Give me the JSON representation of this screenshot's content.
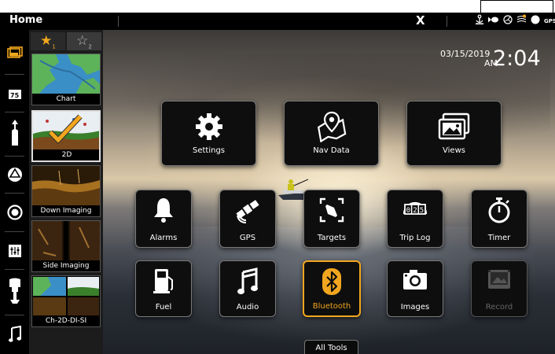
{
  "header": {
    "title": "Home",
    "logo": "X",
    "status_icons": [
      "anchor-icon",
      "fish-icon",
      "radar-icon",
      "chart-update-icon",
      "compass-icon"
    ],
    "gps_label": "GPS"
  },
  "clock": {
    "date": "03/15/2019",
    "ampm": "AM",
    "time": "2:04"
  },
  "left_nav": [
    {
      "name": "home-icon",
      "active": true
    },
    {
      "name": "gauge-icon"
    },
    {
      "name": "vessel-icon"
    },
    {
      "name": "radar-icon"
    },
    {
      "name": "sonar-icon"
    },
    {
      "name": "controls-icon"
    },
    {
      "name": "motor-icon"
    },
    {
      "name": "music-icon"
    }
  ],
  "favorites": {
    "tabs": [
      {
        "label": "★",
        "num": "1",
        "active": true
      },
      {
        "label": "☆",
        "num": "2",
        "active": false
      }
    ],
    "items": [
      {
        "label": "Chart"
      },
      {
        "label": "2D"
      },
      {
        "label": "Down Imaging"
      },
      {
        "label": "Side Imaging"
      },
      {
        "label": "Ch-2D-DI-SI"
      }
    ]
  },
  "tiles": {
    "settings": "Settings",
    "nav_data": "Nav Data",
    "views": "Views",
    "alarms": "Alarms",
    "gps": "GPS",
    "targets": "Targets",
    "trip_log": "Trip Log",
    "timer": "Timer",
    "fuel": "Fuel",
    "audio": "Audio",
    "bluetooth": "Bluetooth",
    "images": "Images",
    "record": "Record"
  },
  "colors": {
    "accent": "#f2a61f",
    "tile_bg": "#0e0e0e",
    "disabled": "#555555"
  },
  "all_tools": "All Tools"
}
